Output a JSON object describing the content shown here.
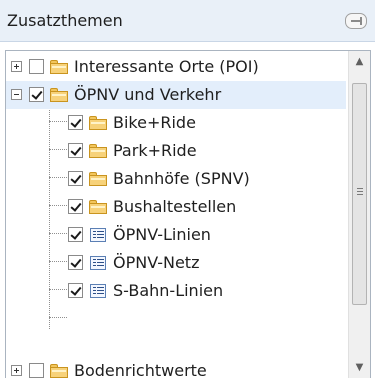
{
  "panel": {
    "title": "Zusatzthemen",
    "pin_icon": "pin-icon"
  },
  "tree": {
    "items": [
      {
        "label": "Interessante Orte (POI)",
        "checked": false,
        "expander": "plus",
        "icon": "folder-icon"
      },
      {
        "label": "ÖPNV und Verkehr",
        "checked": true,
        "expander": "minus",
        "icon": "folder-icon",
        "selected": true
      },
      {
        "label": "Bike+Ride",
        "checked": true,
        "icon": "folder-icon"
      },
      {
        "label": "Park+Ride",
        "checked": true,
        "icon": "folder-icon"
      },
      {
        "label": "Bahnhöfe (SPNV)",
        "checked": true,
        "icon": "folder-icon"
      },
      {
        "label": "Bushaltestellen",
        "checked": true,
        "icon": "folder-icon"
      },
      {
        "label": "ÖPNV-Linien",
        "checked": true,
        "icon": "layer-icon"
      },
      {
        "label": "ÖPNV-Netz",
        "checked": true,
        "icon": "layer-icon"
      },
      {
        "label": "S-Bahn-Linien",
        "checked": true,
        "icon": "layer-icon"
      },
      {
        "label": "Bodenrichtwerte",
        "checked": false,
        "expander": "plus",
        "icon": "folder-icon"
      }
    ]
  },
  "scrollbar": {
    "up_icon": "▲",
    "down_icon": "▼"
  }
}
